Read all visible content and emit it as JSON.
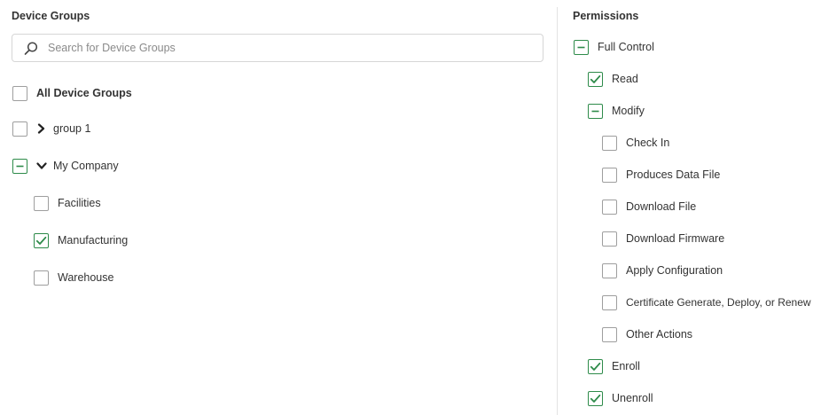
{
  "device_groups": {
    "title": "Device Groups",
    "search_placeholder": "Search for Device Groups",
    "all_label": "All Device Groups",
    "items": [
      {
        "label": "group 1",
        "state": "unchecked",
        "expander": "collapsed"
      },
      {
        "label": "My Company",
        "state": "partial",
        "expander": "expanded"
      },
      {
        "label": "Facilities",
        "state": "unchecked"
      },
      {
        "label": "Manufacturing",
        "state": "checked"
      },
      {
        "label": "Warehouse",
        "state": "unchecked"
      }
    ]
  },
  "permissions": {
    "title": "Permissions",
    "items": [
      {
        "label": "Full Control",
        "state": "partial"
      },
      {
        "label": "Read",
        "state": "checked"
      },
      {
        "label": "Modify",
        "state": "partial"
      },
      {
        "label": "Check In",
        "state": "unchecked"
      },
      {
        "label": "Produces Data File",
        "state": "unchecked"
      },
      {
        "label": "Download File",
        "state": "unchecked"
      },
      {
        "label": "Download Firmware",
        "state": "unchecked"
      },
      {
        "label": "Apply Configuration",
        "state": "unchecked"
      },
      {
        "label": "Certificate Generate, Deploy, or Renew",
        "state": "unchecked"
      },
      {
        "label": "Other Actions",
        "state": "unchecked"
      },
      {
        "label": "Enroll",
        "state": "checked"
      },
      {
        "label": "Unenroll",
        "state": "checked"
      }
    ]
  },
  "colors": {
    "accent": "#2e8b4a",
    "border": "#9e9e9e",
    "divider": "#e3e3e3"
  }
}
